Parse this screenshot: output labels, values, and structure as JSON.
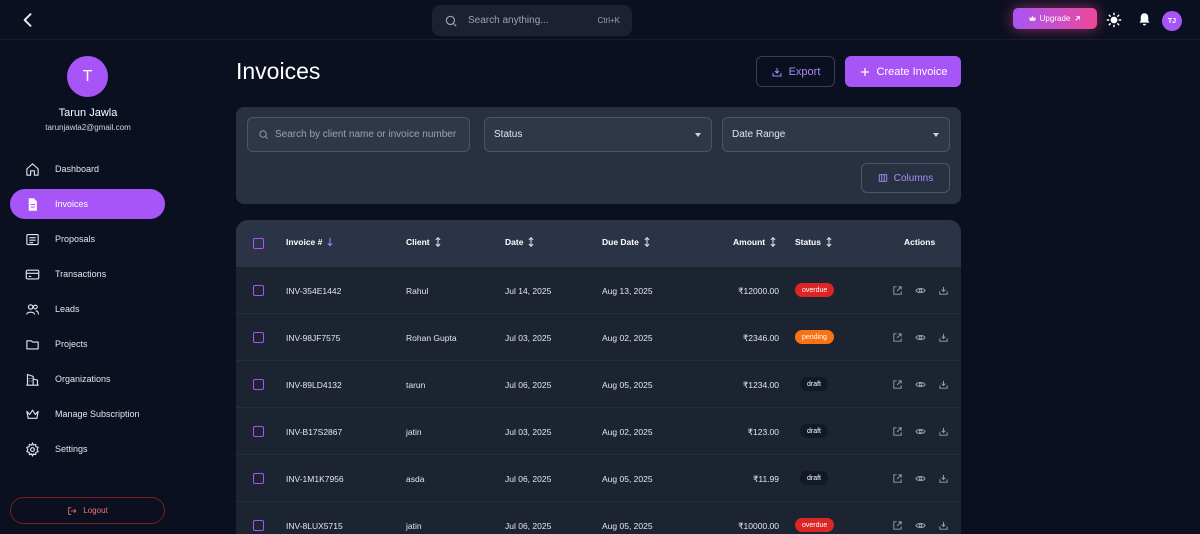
{
  "header": {
    "search_placeholder": "Search anything...",
    "search_shortcut": "Ctrl+K",
    "upgrade_label": "Upgrade",
    "avatar_initials": "TJ"
  },
  "profile": {
    "initial": "T",
    "name": "Tarun Jawla",
    "email": "tarunjawla2@gmail.com"
  },
  "sidebar": {
    "items": [
      {
        "label": "Dashboard",
        "icon": "home-icon",
        "active": false
      },
      {
        "label": "Invoices",
        "icon": "invoice-icon",
        "active": true
      },
      {
        "label": "Proposals",
        "icon": "proposal-icon",
        "active": false
      },
      {
        "label": "Transactions",
        "icon": "card-icon",
        "active": false
      },
      {
        "label": "Leads",
        "icon": "users-icon",
        "active": false
      },
      {
        "label": "Projects",
        "icon": "folder-icon",
        "active": false
      },
      {
        "label": "Organizations",
        "icon": "building-icon",
        "active": false
      },
      {
        "label": "Manage Subscription",
        "icon": "crown-icon",
        "active": false
      },
      {
        "label": "Settings",
        "icon": "gear-icon",
        "active": false
      }
    ],
    "logout_label": "Logout"
  },
  "main": {
    "title": "Invoices",
    "export_label": "Export",
    "create_label": "Create Invoice",
    "filters": {
      "search_placeholder": "Search by client name or invoice number",
      "status_label": "Status",
      "date_range_label": "Date Range",
      "columns_label": "Columns"
    },
    "table": {
      "headers": {
        "invoice": "Invoice #",
        "client": "Client",
        "date": "Date",
        "due_date": "Due Date",
        "amount": "Amount",
        "status": "Status",
        "actions": "Actions"
      },
      "rows": [
        {
          "invoice": "INV-354E1442",
          "client": "Rahul",
          "date": "Jul 14, 2025",
          "due": "Aug 13, 2025",
          "amount": "₹12000.00",
          "status": "overdue"
        },
        {
          "invoice": "INV-98JF7575",
          "client": "Rohan Gupta",
          "date": "Jul 03, 2025",
          "due": "Aug 02, 2025",
          "amount": "₹2346.00",
          "status": "pending"
        },
        {
          "invoice": "INV-89LD4132",
          "client": "tarun",
          "date": "Jul 06, 2025",
          "due": "Aug 05, 2025",
          "amount": "₹1234.00",
          "status": "draft"
        },
        {
          "invoice": "INV-B17S2867",
          "client": "jatin",
          "date": "Jul 03, 2025",
          "due": "Aug 02, 2025",
          "amount": "₹123.00",
          "status": "draft"
        },
        {
          "invoice": "INV-1M1K7956",
          "client": "asda",
          "date": "Jul 06, 2025",
          "due": "Aug 05, 2025",
          "amount": "₹11.99",
          "status": "draft"
        },
        {
          "invoice": "INV-8LUX5715",
          "client": "jatin",
          "date": "Jul 06, 2025",
          "due": "Aug 05, 2025",
          "amount": "₹10000.00",
          "status": "overdue"
        }
      ]
    }
  },
  "colors": {
    "accent": "#a855f7",
    "overdue": "#dc2626",
    "pending": "#f97316",
    "draft": "#111827"
  }
}
